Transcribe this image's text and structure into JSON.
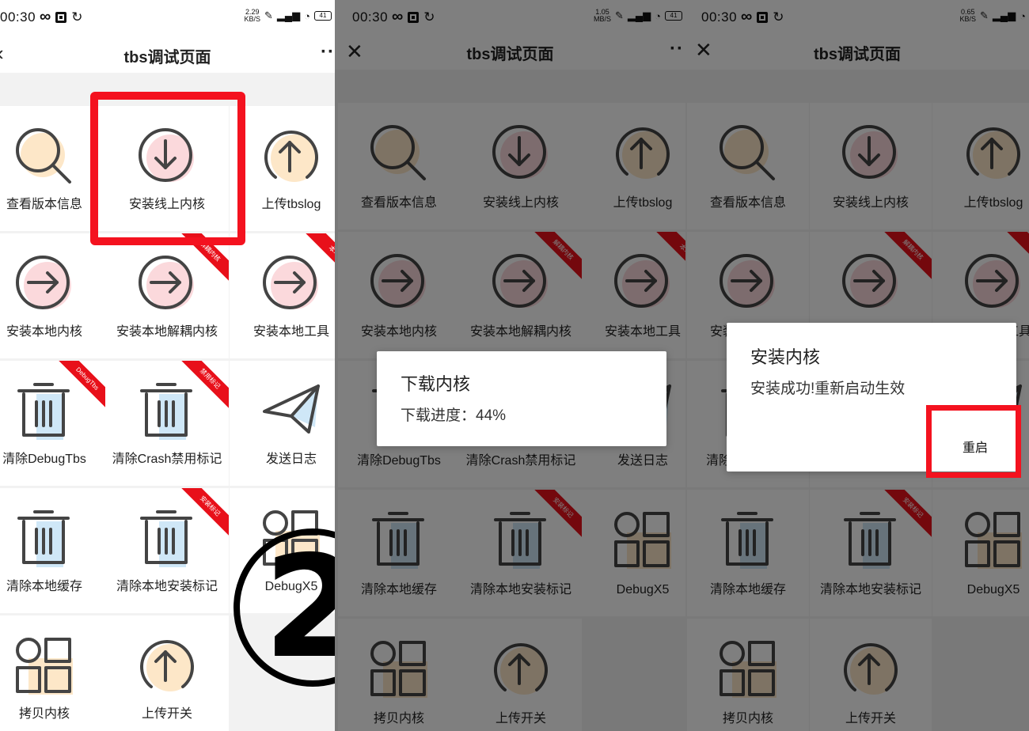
{
  "status": {
    "time": "00:30",
    "battery": "41",
    "speeds": [
      "2.29\nKB/S",
      "1.05\nMB/S",
      "0.65\nKB/S"
    ]
  },
  "titlebar": {
    "title": "tbs调试页面",
    "close": "✕",
    "more": "··"
  },
  "grid": {
    "items": [
      {
        "label": "查看版本信息",
        "icon": "magnifier-icon",
        "ribbon": ""
      },
      {
        "label": "安装线上内核",
        "icon": "download-arrow-icon",
        "ribbon": ""
      },
      {
        "label": "上传tbslog",
        "icon": "upload-arrow-icon",
        "ribbon": ""
      },
      {
        "label": "安装本地内核",
        "icon": "right-arrow-icon",
        "ribbon": ""
      },
      {
        "label": "安装本地解耦内核",
        "icon": "right-arrow-icon",
        "ribbon": "解耦内核"
      },
      {
        "label": "安装本地工具",
        "icon": "right-arrow-icon",
        "ribbon": "本地"
      },
      {
        "label": "清除DebugTbs",
        "icon": "trash-icon",
        "ribbon": "DebugTbs"
      },
      {
        "label": "清除Crash禁用标记",
        "icon": "trash-icon",
        "ribbon": "禁用标记"
      },
      {
        "label": "发送日志",
        "icon": "paper-plane-icon",
        "ribbon": ""
      },
      {
        "label": "清除本地缓存",
        "icon": "trash-icon",
        "ribbon": ""
      },
      {
        "label": "清除本地安装标记",
        "icon": "trash-icon",
        "ribbon": "安装标记"
      },
      {
        "label": "DebugX5",
        "icon": "grid-squares-icon",
        "ribbon": ""
      },
      {
        "label": "拷贝内核",
        "icon": "grid-squares-icon",
        "ribbon": ""
      },
      {
        "label": "上传开关",
        "icon": "upload-arrow-icon",
        "ribbon": ""
      }
    ]
  },
  "download_dialog": {
    "title": "下载内核",
    "message": "下载进度：44%",
    "progress_percent": 44
  },
  "install_dialog": {
    "title": "安装内核",
    "message": "安装成功!重新启动生效",
    "button": "重启"
  },
  "annotation": {
    "step": "2"
  },
  "colors": {
    "highlight": "#f4121f",
    "ribbon": "#e8101a",
    "pink": "#fbd9dc",
    "peach": "#fde7c8",
    "blue": "#cfe7f7"
  }
}
